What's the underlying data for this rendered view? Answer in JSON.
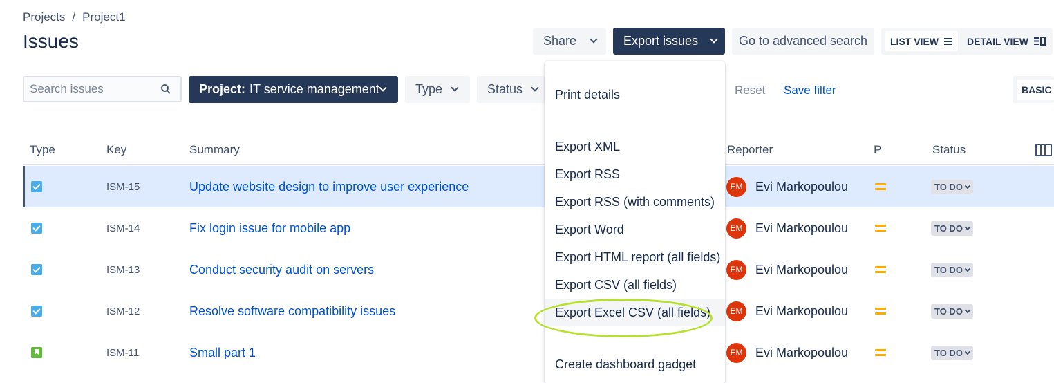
{
  "breadcrumb": [
    "Projects",
    "/",
    "Project1"
  ],
  "page_title": "Issues",
  "toolbar": {
    "share": "Share",
    "export": "Export issues",
    "advanced_search": "Go to advanced search",
    "list_view": "LIST VIEW",
    "detail_view": "DETAIL VIEW"
  },
  "filters": {
    "search_placeholder": "Search issues",
    "project_label": "Project:",
    "project_value": "IT service management",
    "type": "Type",
    "status": "Status",
    "reset": "Reset",
    "save_filter": "Save filter",
    "basic": "BASIC"
  },
  "columns": [
    "Type",
    "Key",
    "Summary",
    "Reporter",
    "P",
    "Status"
  ],
  "rows": [
    {
      "type": "task",
      "key": "ISM-15",
      "summary": "Update website design to improve user experience",
      "avatar": "EM",
      "reporter": "Evi Markopoulou",
      "status": "TO DO"
    },
    {
      "type": "task",
      "key": "ISM-14",
      "summary": "Fix login issue for mobile app",
      "avatar": "EM",
      "reporter": "Evi Markopoulou",
      "status": "TO DO"
    },
    {
      "type": "task",
      "key": "ISM-13",
      "summary": "Conduct security audit on servers",
      "avatar": "EM",
      "reporter": "Evi Markopoulou",
      "status": "TO DO"
    },
    {
      "type": "task",
      "key": "ISM-12",
      "summary": "Resolve software compatibility issues",
      "avatar": "EM",
      "reporter": "Evi Markopoulou",
      "status": "TO DO"
    },
    {
      "type": "story",
      "key": "ISM-11",
      "summary": "Small part 1",
      "avatar": "EM",
      "reporter": "Evi Markopoulou",
      "status": "TO DO"
    }
  ],
  "export_menu": [
    "Print details",
    "Export XML",
    "Export RSS",
    "Export RSS (with comments)",
    "Export Word",
    "Export HTML report (all fields)",
    "Export CSV (all fields)",
    "Export Excel CSV (all fields)",
    "Create dashboard gadget"
  ],
  "colors": {
    "dark_button": "#253858",
    "link": "#0052cc",
    "avatar": "#de350b",
    "priority_medium": "#ffab00",
    "highlight": "#b6e02a",
    "selected_row": "#deebff"
  }
}
